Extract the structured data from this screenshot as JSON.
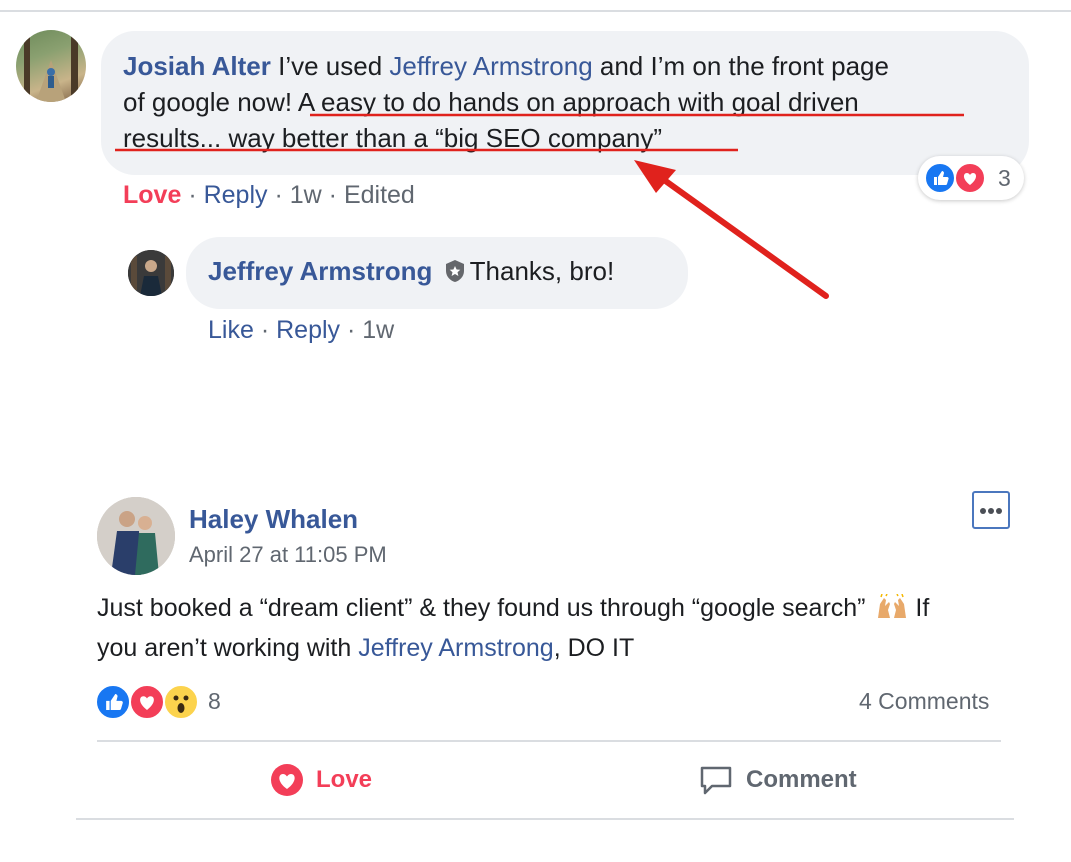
{
  "comment1": {
    "author": "Josiah Alter",
    "text_pre": " I’ve used ",
    "mention": "Jeffrey Armstrong",
    "text_mid_line1": " and I’m on the front page",
    "text_line2_a": "of google now!",
    "text_line2_b": " A easy to do hands on approach with goal driven",
    "text_line3": "results... way better than a “big SEO company”",
    "actions": {
      "reaction": "Love",
      "reply": "Reply",
      "age": "1w",
      "edited": "Edited"
    },
    "reactions": {
      "count": "3",
      "icons": [
        "like-icon",
        "love-icon"
      ]
    }
  },
  "reply1": {
    "author": "Jeffrey Armstrong",
    "badge_icon": "shield-badge-icon",
    "text": "Thanks, bro!",
    "actions": {
      "like": "Like",
      "reply": "Reply",
      "age": "1w"
    }
  },
  "post": {
    "author": "Haley Whalen",
    "timestamp": "April 27 at 11:05 PM",
    "more_icon": "more-options-icon",
    "text_line1": "Just booked a “dream client” & they found us through “google search”",
    "text_line1_end": " If",
    "emoji": "raising-hands-icon",
    "text_line2_pre": "you aren’t working with ",
    "mention": "Jeffrey Armstrong",
    "text_line2_post": ", DO IT",
    "reactions": {
      "count": "8",
      "icons": [
        "like-icon",
        "love-icon",
        "wow-icon"
      ]
    },
    "comments_count": "4 Comments",
    "action_love": "Love",
    "action_comment": "Comment"
  },
  "colors": {
    "link": "#385898",
    "love": "#f33e58",
    "like": "#1877f2",
    "annotation": "#e0221d",
    "bubble": "#f0f2f5"
  }
}
